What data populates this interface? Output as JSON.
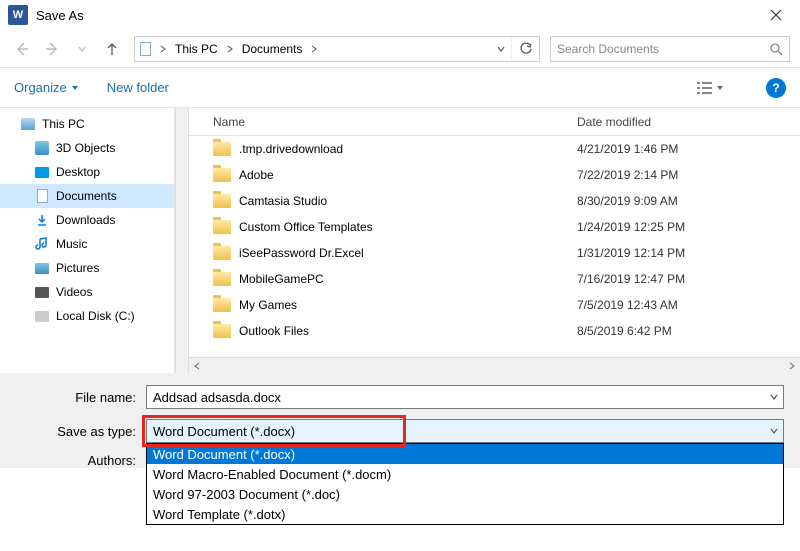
{
  "window": {
    "title": "Save As",
    "word_glyph": "W"
  },
  "nav": {
    "breadcrumbs": [
      "This PC",
      "Documents"
    ],
    "search_placeholder": "Search Documents"
  },
  "toolbar": {
    "organize": "Organize",
    "new_folder": "New folder"
  },
  "sidebar": {
    "items": [
      {
        "label": "This PC",
        "icon": "pc"
      },
      {
        "label": "3D Objects",
        "icon": "3d"
      },
      {
        "label": "Desktop",
        "icon": "desktop"
      },
      {
        "label": "Documents",
        "icon": "doc",
        "selected": true
      },
      {
        "label": "Downloads",
        "icon": "dl"
      },
      {
        "label": "Music",
        "icon": "music"
      },
      {
        "label": "Pictures",
        "icon": "pic"
      },
      {
        "label": "Videos",
        "icon": "vid"
      },
      {
        "label": "Local Disk (C:)",
        "icon": "disk"
      }
    ]
  },
  "columns": {
    "name": "Name",
    "date": "Date modified"
  },
  "files": [
    {
      "name": ".tmp.drivedownload",
      "date": "4/21/2019 1:46 PM"
    },
    {
      "name": "Adobe",
      "date": "7/22/2019 2:14 PM"
    },
    {
      "name": "Camtasia Studio",
      "date": "8/30/2019 9:09 AM"
    },
    {
      "name": "Custom Office Templates",
      "date": "1/24/2019 12:25 PM"
    },
    {
      "name": "iSeePassword Dr.Excel",
      "date": "1/31/2019 12:14 PM"
    },
    {
      "name": "MobileGamePC",
      "date": "7/16/2019 12:47 PM"
    },
    {
      "name": "My Games",
      "date": "7/5/2019 12:43 AM"
    },
    {
      "name": "Outlook Files",
      "date": "8/5/2019 6:42 PM"
    }
  ],
  "form": {
    "filename_label": "File name:",
    "filename_value": "Addsad adsasda.docx",
    "saveastype_label": "Save as type:",
    "saveastype_selected": "Word Document (*.docx)",
    "authors_label": "Authors:",
    "type_options": [
      "Word Document (*.docx)",
      "Word Macro-Enabled Document (*.docm)",
      "Word 97-2003 Document (*.doc)",
      "Word Template (*.dotx)"
    ]
  }
}
